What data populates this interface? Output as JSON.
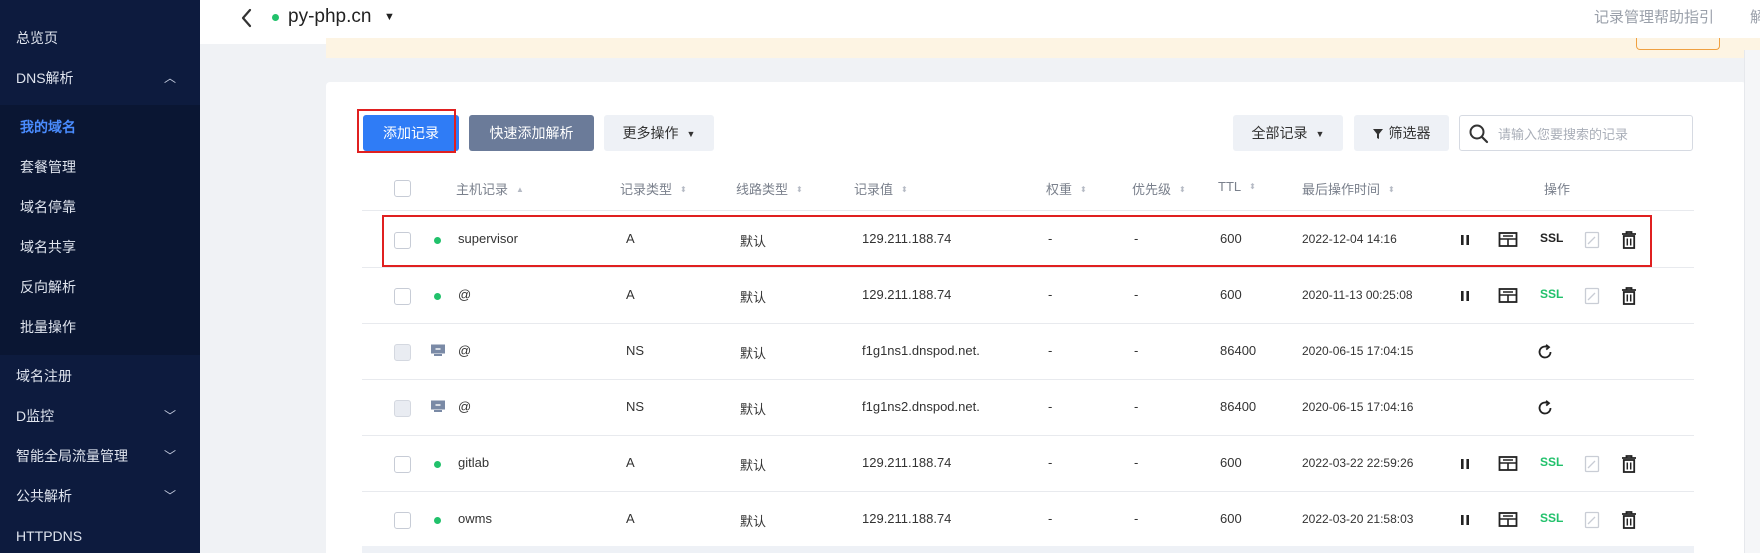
{
  "sidebar": {
    "items": [
      {
        "label": "总览页"
      },
      {
        "label": "DNS解析",
        "chevron": "up"
      }
    ],
    "sub_items": [
      {
        "label": "我的域名",
        "active": true
      },
      {
        "label": "套餐管理"
      },
      {
        "label": "域名停靠"
      },
      {
        "label": "域名共享"
      },
      {
        "label": "反向解析"
      },
      {
        "label": "批量操作"
      }
    ],
    "bottom_items": [
      {
        "label": "域名注册"
      },
      {
        "label": "D监控",
        "chevron": "down"
      },
      {
        "label": "智能全局流量管理",
        "chevron": "down"
      },
      {
        "label": "公共解析",
        "chevron": "down"
      },
      {
        "label": "HTTPDNS"
      }
    ]
  },
  "header": {
    "domain": "py-php.cn",
    "help_link": "记录管理帮助指引",
    "right_truncated": "解"
  },
  "toolbar": {
    "add_record": "添加记录",
    "quick_add": "快速添加解析",
    "more_actions": "更多操作",
    "all_records": "全部记录",
    "filter": "筛选器",
    "search_placeholder": "请输入您要搜索的记录"
  },
  "table": {
    "headers": {
      "host": "主机记录",
      "type": "记录类型",
      "line": "线路类型",
      "value": "记录值",
      "weight": "权重",
      "priority": "优先级",
      "ttl": "TTL",
      "last_modified": "最后操作时间",
      "actions": "操作"
    },
    "rows": [
      {
        "host": "supervisor",
        "type": "A",
        "line": "默认",
        "value": "129.211.188.74",
        "weight": "-",
        "priority": "-",
        "ttl": "600",
        "time": "2022-12-04 14:16",
        "kind": "normal",
        "ssl": "SSL",
        "ssl_color": "#222222"
      },
      {
        "host": "@",
        "type": "A",
        "line": "默认",
        "value": "129.211.188.74",
        "weight": "-",
        "priority": "-",
        "ttl": "600",
        "time": "2020-11-13 00:25:08",
        "kind": "normal",
        "ssl": "SSL",
        "ssl_color": "#21c16b"
      },
      {
        "host": "@",
        "type": "NS",
        "line": "默认",
        "value": "f1g1ns1.dnspod.net.",
        "weight": "-",
        "priority": "-",
        "ttl": "86400",
        "time": "2020-06-15 17:04:15",
        "kind": "ns"
      },
      {
        "host": "@",
        "type": "NS",
        "line": "默认",
        "value": "f1g1ns2.dnspod.net.",
        "weight": "-",
        "priority": "-",
        "ttl": "86400",
        "time": "2020-06-15 17:04:16",
        "kind": "ns"
      },
      {
        "host": "gitlab",
        "type": "A",
        "line": "默认",
        "value": "129.211.188.74",
        "weight": "-",
        "priority": "-",
        "ttl": "600",
        "time": "2022-03-22 22:59:26",
        "kind": "normal",
        "ssl": "SSL",
        "ssl_color": "#21c16b"
      },
      {
        "host": "owms",
        "type": "A",
        "line": "默认",
        "value": "129.211.188.74",
        "weight": "-",
        "priority": "-",
        "ttl": "600",
        "time": "2022-03-20 21:58:03",
        "kind": "normal",
        "ssl": "SSL",
        "ssl_color": "#21c16b"
      }
    ]
  },
  "colors": {
    "sidebar_bg": "#0d1b3e",
    "primary": "#2f7cf6",
    "status_green": "#21c16b",
    "highlight_red": "#e02020"
  }
}
